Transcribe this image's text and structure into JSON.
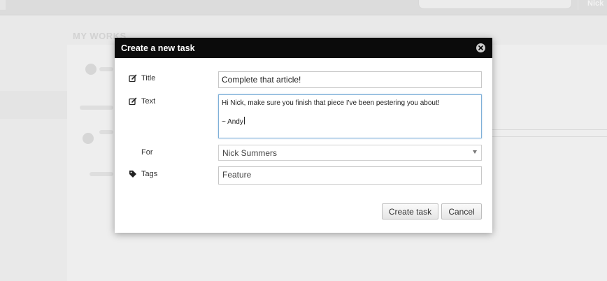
{
  "background": {
    "user_name": "Nick",
    "workspace_title": "MY WORKS"
  },
  "modal": {
    "title": "Create a new task",
    "close_icon": "close-circle-icon",
    "fields": {
      "title": {
        "label": "Title",
        "icon": "edit-icon",
        "value": "Complete that article!"
      },
      "text": {
        "label": "Text",
        "icon": "edit-icon",
        "lines": [
          "Hi Nick, make sure you finish that piece I've been pestering you about!",
          "",
          "~ Andy"
        ]
      },
      "for": {
        "label": "For",
        "selected": "Nick Summers"
      },
      "tags": {
        "label": "Tags",
        "icon": "tag-icon",
        "value": "Feature"
      }
    },
    "buttons": {
      "create": "Create task",
      "cancel": "Cancel"
    }
  },
  "colors": {
    "header_bg": "#0b0b0b",
    "overlay_bg": "#e9e9e9",
    "focus_border": "#7fb0d8"
  }
}
